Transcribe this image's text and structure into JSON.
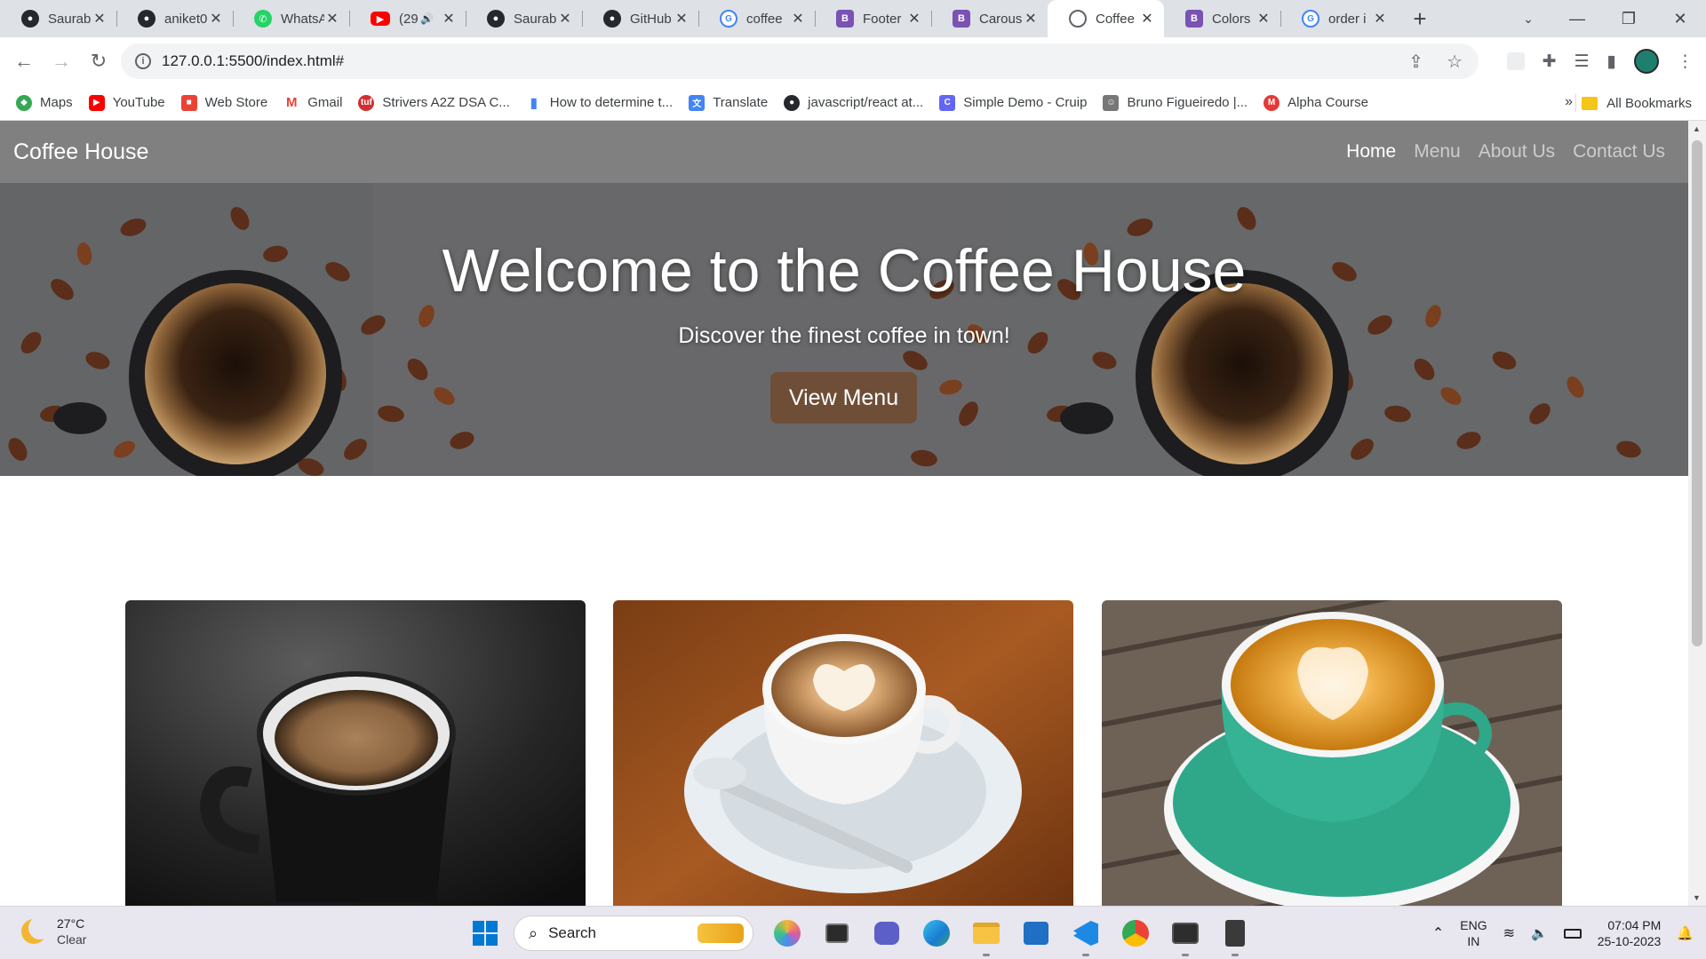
{
  "browser": {
    "tabs": [
      {
        "title": "Saurab",
        "icon": "github-icon"
      },
      {
        "title": "aniket0",
        "icon": "github-icon"
      },
      {
        "title": "WhatsA",
        "icon": "whatsapp-icon"
      },
      {
        "title": "(29",
        "icon": "youtube-icon",
        "audio": "🔊"
      },
      {
        "title": "Saurab",
        "icon": "github-icon"
      },
      {
        "title": "GitHub",
        "icon": "github-icon"
      },
      {
        "title": "coffee",
        "icon": "google-icon"
      },
      {
        "title": "Footer",
        "icon": "bootstrap-icon"
      },
      {
        "title": "Carous",
        "icon": "bootstrap-icon"
      },
      {
        "title": "Coffee",
        "icon": "globe-icon",
        "active": true
      },
      {
        "title": "Colors",
        "icon": "bootstrap-icon"
      },
      {
        "title": "order i",
        "icon": "google-icon"
      }
    ],
    "url": "127.0.0.1:5500/index.html#",
    "bookmarks": [
      {
        "label": "Maps",
        "icon": "maps-icon",
        "color": "#34a853"
      },
      {
        "label": "YouTube",
        "icon": "youtube-icon",
        "color": "#ff0000"
      },
      {
        "label": "Web Store",
        "icon": "webstore-icon",
        "color": "#ea4335"
      },
      {
        "label": "Gmail",
        "icon": "gmail-icon",
        "color": "#ea4335"
      },
      {
        "label": "Strivers A2Z DSA C...",
        "icon": "tuf-icon",
        "color": "#d32f2f"
      },
      {
        "label": "How to determine t...",
        "icon": "chart-icon",
        "color": "#fbbc04"
      },
      {
        "label": "Translate",
        "icon": "translate-icon",
        "color": "#4285f4"
      },
      {
        "label": "javascript/react at...",
        "icon": "github-icon",
        "color": "#24292f"
      },
      {
        "label": "Simple Demo - Cruip",
        "icon": "cruip-icon",
        "color": "#6366f1"
      },
      {
        "label": "Bruno Figueiredo |...",
        "icon": "avatar-icon",
        "color": "#777777"
      },
      {
        "label": "Alpha Course",
        "icon": "alpha-icon",
        "color": "#e53935"
      }
    ],
    "all_bookmarks": "All Bookmarks"
  },
  "site": {
    "brand": "Coffee House",
    "nav": [
      "Home",
      "Menu",
      "About Us",
      "Contact Us"
    ],
    "active_nav": "Home",
    "hero": {
      "title": "Welcome to the Coffee House",
      "subtitle": "Discover the finest coffee in town!",
      "button": "View Menu"
    },
    "accent": "#6f4e37",
    "navbar_bg": "#808080",
    "cards": [
      {
        "image": "espresso-cup-image"
      },
      {
        "image": "latte-art-cup-image"
      },
      {
        "image": "cappuccino-green-cup-image"
      }
    ]
  },
  "taskbar": {
    "weather_temp": "27°C",
    "weather_desc": "Clear",
    "search": "Search",
    "lang_top": "ENG",
    "lang_bottom": "IN",
    "time": "07:04 PM",
    "date": "25-10-2023"
  }
}
